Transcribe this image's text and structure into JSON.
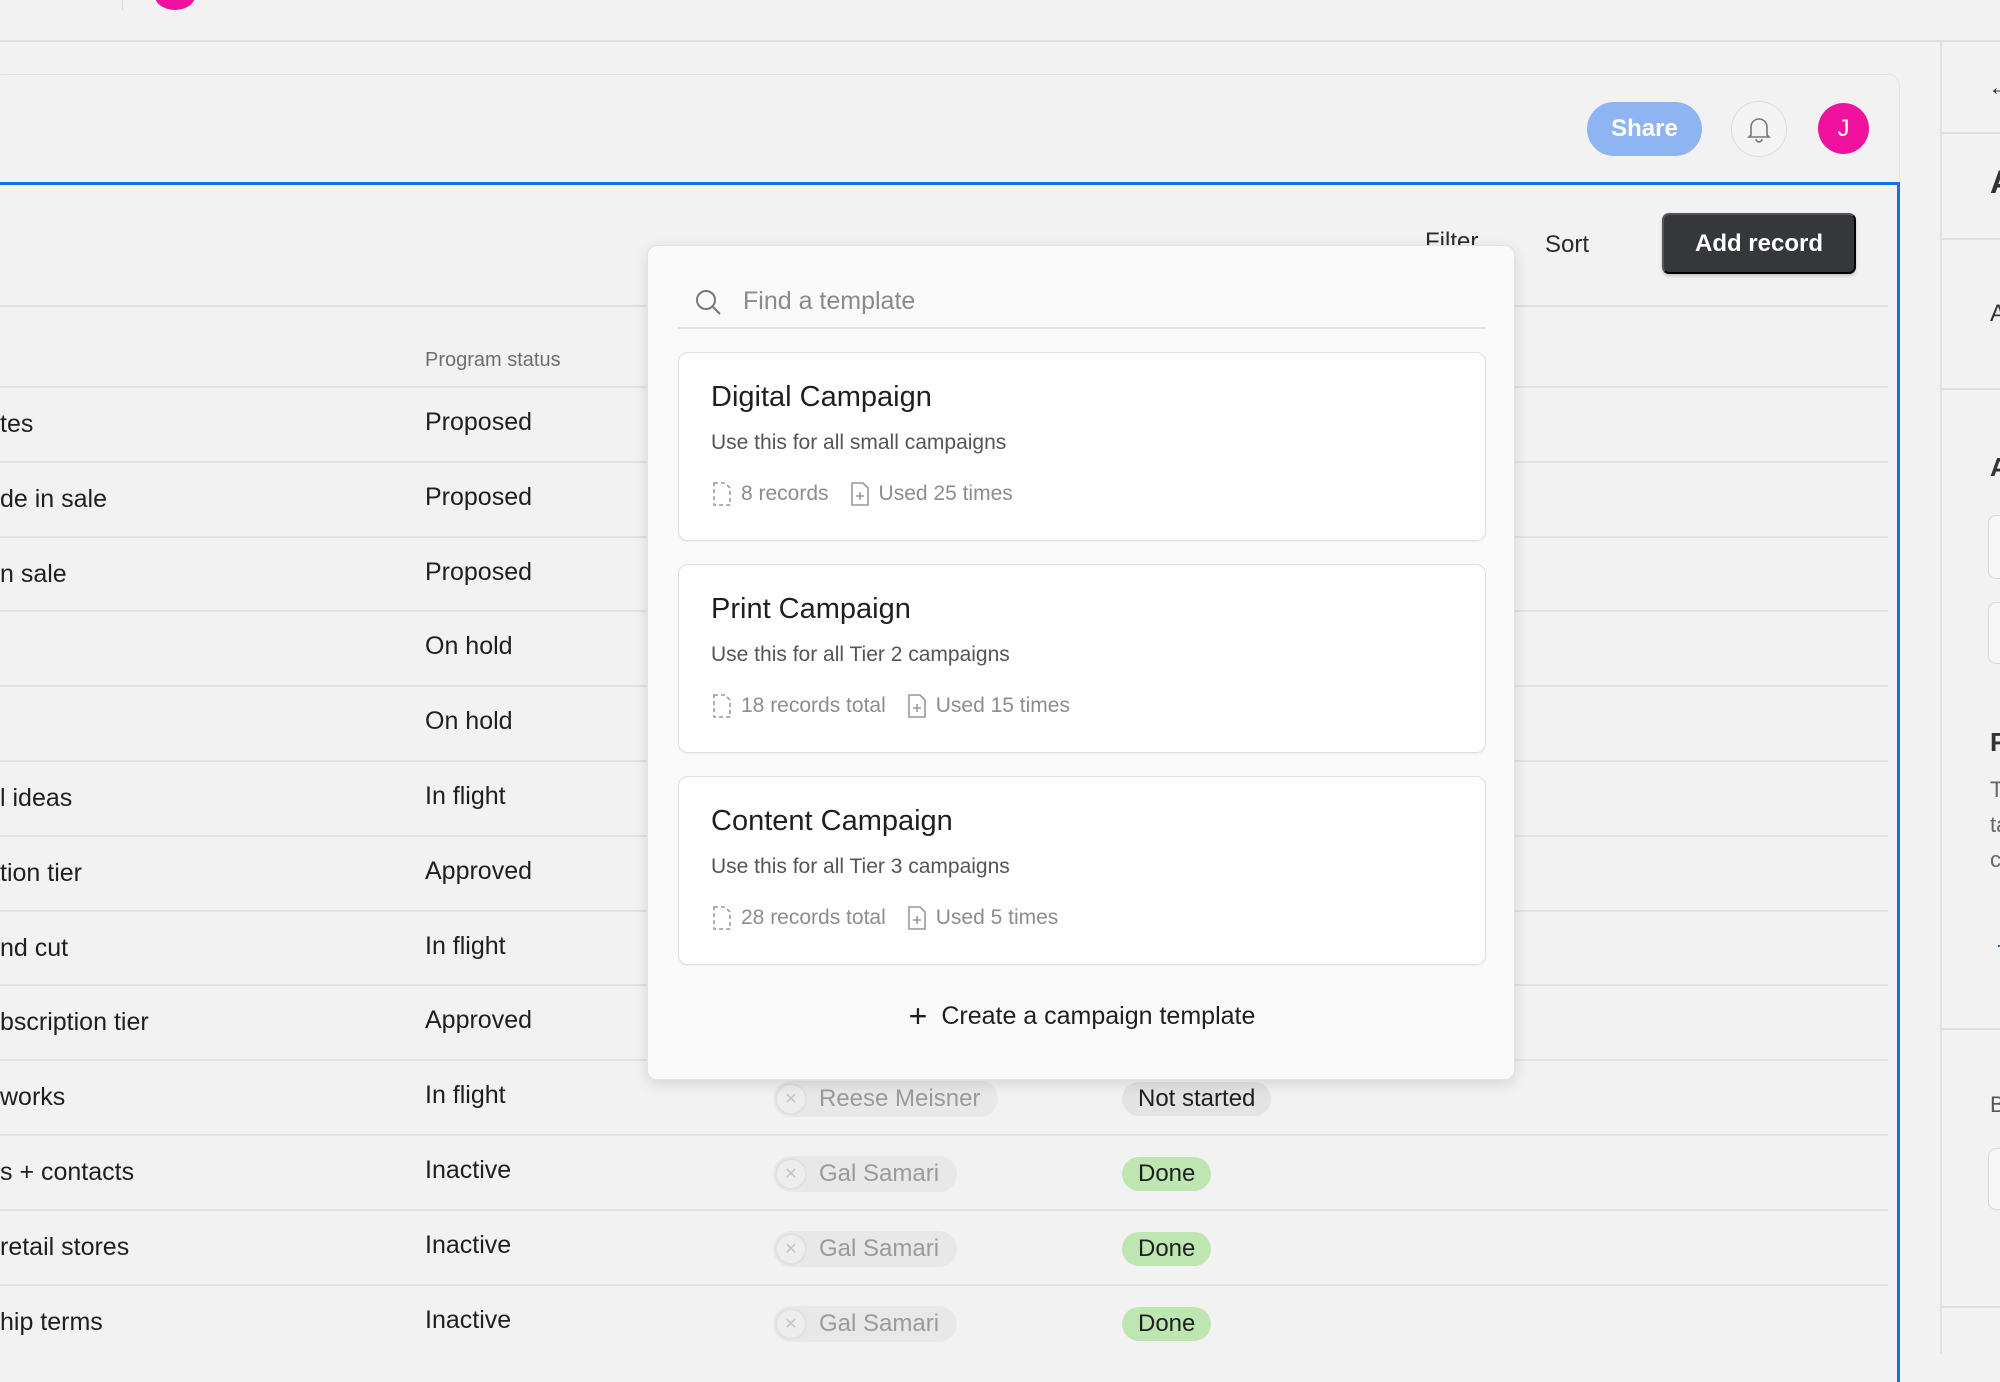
{
  "header": {
    "share_label": "Share",
    "avatar_initial": "J"
  },
  "toolbar": {
    "filter_label": "Filter",
    "sort_label": "Sort",
    "add_record_label": "Add record"
  },
  "table": {
    "column_program_status": "Program status",
    "rows": [
      {
        "name": "tes",
        "status": "Proposed"
      },
      {
        "name": "de in sale",
        "status": "Proposed"
      },
      {
        "name": "n sale",
        "status": "Proposed"
      },
      {
        "name": "",
        "status": "On hold"
      },
      {
        "name": "",
        "status": "On hold"
      },
      {
        "name": "l ideas",
        "status": "In flight"
      },
      {
        "name": "tion tier",
        "status": "Approved"
      },
      {
        "name": "nd cut",
        "status": "In flight"
      },
      {
        "name": "bscription tier",
        "status": "Approved"
      },
      {
        "name": "works",
        "status": "In flight",
        "assignee": "Reese Meisner",
        "task_status": "Not started"
      },
      {
        "name": "s + contacts",
        "status": "Inactive",
        "assignee": "Gal Samari",
        "task_status": "Done"
      },
      {
        "name": " retail stores",
        "status": "Inactive",
        "assignee": "Gal Samari",
        "task_status": "Done"
      },
      {
        "name": "hip terms",
        "status": "Inactive",
        "assignee": "Gal Samari",
        "task_status": "Done"
      }
    ]
  },
  "colors": {
    "accent": "#1a6ee8",
    "share": "#8fb4f2",
    "avatar": "#f0119e",
    "done": "#bde6b1",
    "not_started": "#e3e3e3",
    "add_record": "#36373a"
  },
  "template_picker": {
    "search_placeholder": "Find a template",
    "templates": [
      {
        "title": "Digital Campaign",
        "description": "Use this for all small campaigns",
        "records": "8 records",
        "used": "Used 25 times"
      },
      {
        "title": "Print Campaign",
        "description": "Use this for all Tier 2 campaigns",
        "records": "18 records total",
        "used": "Used 15 times"
      },
      {
        "title": "Content Campaign",
        "description": "Use this for all Tier 3 campaigns",
        "records": "28 records total",
        "used": "Used 5 times"
      }
    ],
    "create_label": "Create a campaign template"
  },
  "right_panel": {
    "texts": [
      "A",
      "A",
      "A",
      "R",
      "T",
      "ta",
      "c",
      "B"
    ]
  }
}
